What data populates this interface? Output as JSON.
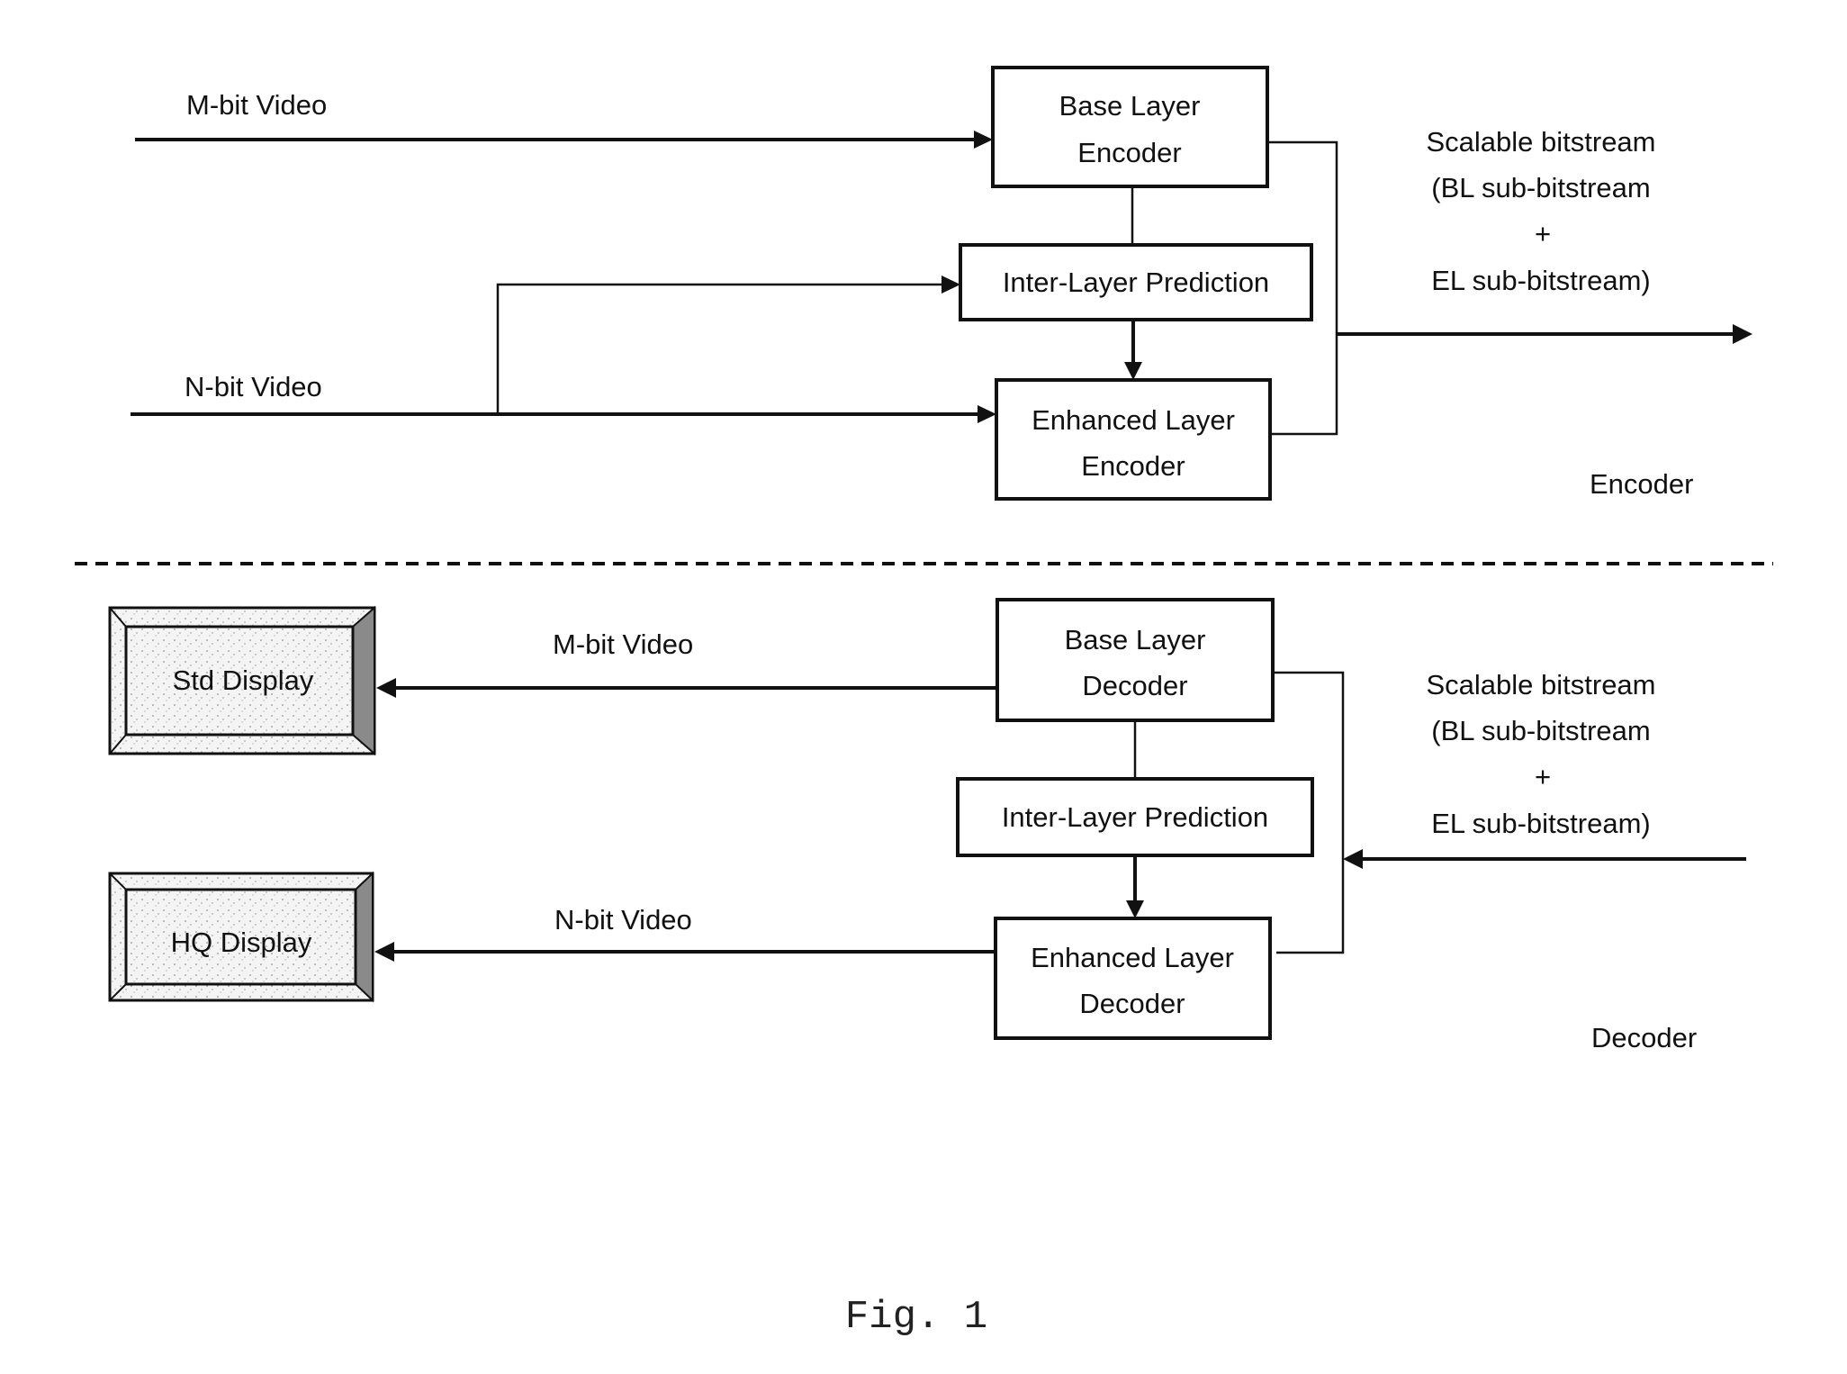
{
  "figure": {
    "caption": "Fig. 1"
  },
  "encoder": {
    "section_label": "Encoder",
    "inputs": {
      "m_bit": "M-bit Video",
      "n_bit": "N-bit Video"
    },
    "blocks": {
      "base_layer": [
        "Base Layer",
        "Encoder"
      ],
      "inter_layer": "Inter-Layer Prediction",
      "enhanced_layer": [
        "Enhanced Layer",
        "Encoder"
      ]
    },
    "output_label": [
      "Scalable bitstream",
      "(BL sub-bitstream",
      "+",
      "EL sub-bitstream)"
    ]
  },
  "decoder": {
    "section_label": "Decoder",
    "input_label": [
      "Scalable bitstream",
      "(BL sub-bitstream",
      "+",
      "EL sub-bitstream)"
    ],
    "blocks": {
      "base_layer": [
        "Base Layer",
        "Decoder"
      ],
      "inter_layer": "Inter-Layer Prediction",
      "enhanced_layer": [
        "Enhanced Layer",
        "Decoder"
      ]
    },
    "outputs": {
      "m_bit": "M-bit Video",
      "n_bit": "N-bit Video"
    },
    "displays": {
      "std": "Std Display",
      "hq": "HQ Display"
    }
  }
}
